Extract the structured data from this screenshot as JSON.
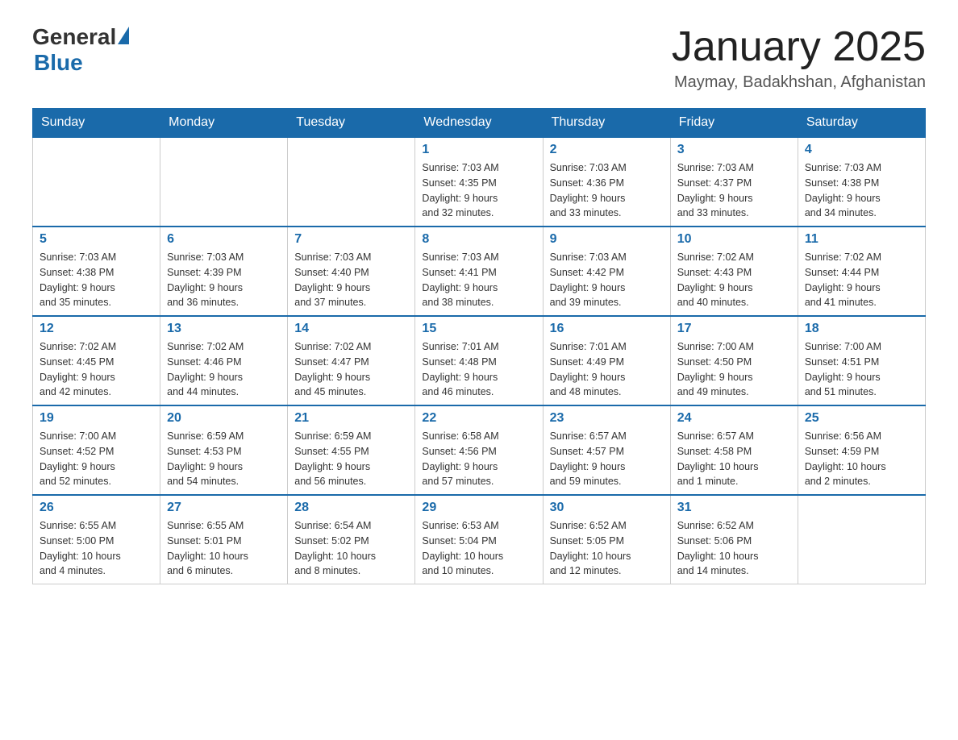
{
  "header": {
    "logo_general": "General",
    "logo_blue": "Blue",
    "month_year": "January 2025",
    "location": "Maymay, Badakhshan, Afghanistan"
  },
  "days_of_week": [
    "Sunday",
    "Monday",
    "Tuesday",
    "Wednesday",
    "Thursday",
    "Friday",
    "Saturday"
  ],
  "weeks": [
    [
      {
        "day": "",
        "info": ""
      },
      {
        "day": "",
        "info": ""
      },
      {
        "day": "",
        "info": ""
      },
      {
        "day": "1",
        "info": "Sunrise: 7:03 AM\nSunset: 4:35 PM\nDaylight: 9 hours\nand 32 minutes."
      },
      {
        "day": "2",
        "info": "Sunrise: 7:03 AM\nSunset: 4:36 PM\nDaylight: 9 hours\nand 33 minutes."
      },
      {
        "day": "3",
        "info": "Sunrise: 7:03 AM\nSunset: 4:37 PM\nDaylight: 9 hours\nand 33 minutes."
      },
      {
        "day": "4",
        "info": "Sunrise: 7:03 AM\nSunset: 4:38 PM\nDaylight: 9 hours\nand 34 minutes."
      }
    ],
    [
      {
        "day": "5",
        "info": "Sunrise: 7:03 AM\nSunset: 4:38 PM\nDaylight: 9 hours\nand 35 minutes."
      },
      {
        "day": "6",
        "info": "Sunrise: 7:03 AM\nSunset: 4:39 PM\nDaylight: 9 hours\nand 36 minutes."
      },
      {
        "day": "7",
        "info": "Sunrise: 7:03 AM\nSunset: 4:40 PM\nDaylight: 9 hours\nand 37 minutes."
      },
      {
        "day": "8",
        "info": "Sunrise: 7:03 AM\nSunset: 4:41 PM\nDaylight: 9 hours\nand 38 minutes."
      },
      {
        "day": "9",
        "info": "Sunrise: 7:03 AM\nSunset: 4:42 PM\nDaylight: 9 hours\nand 39 minutes."
      },
      {
        "day": "10",
        "info": "Sunrise: 7:02 AM\nSunset: 4:43 PM\nDaylight: 9 hours\nand 40 minutes."
      },
      {
        "day": "11",
        "info": "Sunrise: 7:02 AM\nSunset: 4:44 PM\nDaylight: 9 hours\nand 41 minutes."
      }
    ],
    [
      {
        "day": "12",
        "info": "Sunrise: 7:02 AM\nSunset: 4:45 PM\nDaylight: 9 hours\nand 42 minutes."
      },
      {
        "day": "13",
        "info": "Sunrise: 7:02 AM\nSunset: 4:46 PM\nDaylight: 9 hours\nand 44 minutes."
      },
      {
        "day": "14",
        "info": "Sunrise: 7:02 AM\nSunset: 4:47 PM\nDaylight: 9 hours\nand 45 minutes."
      },
      {
        "day": "15",
        "info": "Sunrise: 7:01 AM\nSunset: 4:48 PM\nDaylight: 9 hours\nand 46 minutes."
      },
      {
        "day": "16",
        "info": "Sunrise: 7:01 AM\nSunset: 4:49 PM\nDaylight: 9 hours\nand 48 minutes."
      },
      {
        "day": "17",
        "info": "Sunrise: 7:00 AM\nSunset: 4:50 PM\nDaylight: 9 hours\nand 49 minutes."
      },
      {
        "day": "18",
        "info": "Sunrise: 7:00 AM\nSunset: 4:51 PM\nDaylight: 9 hours\nand 51 minutes."
      }
    ],
    [
      {
        "day": "19",
        "info": "Sunrise: 7:00 AM\nSunset: 4:52 PM\nDaylight: 9 hours\nand 52 minutes."
      },
      {
        "day": "20",
        "info": "Sunrise: 6:59 AM\nSunset: 4:53 PM\nDaylight: 9 hours\nand 54 minutes."
      },
      {
        "day": "21",
        "info": "Sunrise: 6:59 AM\nSunset: 4:55 PM\nDaylight: 9 hours\nand 56 minutes."
      },
      {
        "day": "22",
        "info": "Sunrise: 6:58 AM\nSunset: 4:56 PM\nDaylight: 9 hours\nand 57 minutes."
      },
      {
        "day": "23",
        "info": "Sunrise: 6:57 AM\nSunset: 4:57 PM\nDaylight: 9 hours\nand 59 minutes."
      },
      {
        "day": "24",
        "info": "Sunrise: 6:57 AM\nSunset: 4:58 PM\nDaylight: 10 hours\nand 1 minute."
      },
      {
        "day": "25",
        "info": "Sunrise: 6:56 AM\nSunset: 4:59 PM\nDaylight: 10 hours\nand 2 minutes."
      }
    ],
    [
      {
        "day": "26",
        "info": "Sunrise: 6:55 AM\nSunset: 5:00 PM\nDaylight: 10 hours\nand 4 minutes."
      },
      {
        "day": "27",
        "info": "Sunrise: 6:55 AM\nSunset: 5:01 PM\nDaylight: 10 hours\nand 6 minutes."
      },
      {
        "day": "28",
        "info": "Sunrise: 6:54 AM\nSunset: 5:02 PM\nDaylight: 10 hours\nand 8 minutes."
      },
      {
        "day": "29",
        "info": "Sunrise: 6:53 AM\nSunset: 5:04 PM\nDaylight: 10 hours\nand 10 minutes."
      },
      {
        "day": "30",
        "info": "Sunrise: 6:52 AM\nSunset: 5:05 PM\nDaylight: 10 hours\nand 12 minutes."
      },
      {
        "day": "31",
        "info": "Sunrise: 6:52 AM\nSunset: 5:06 PM\nDaylight: 10 hours\nand 14 minutes."
      },
      {
        "day": "",
        "info": ""
      }
    ]
  ]
}
